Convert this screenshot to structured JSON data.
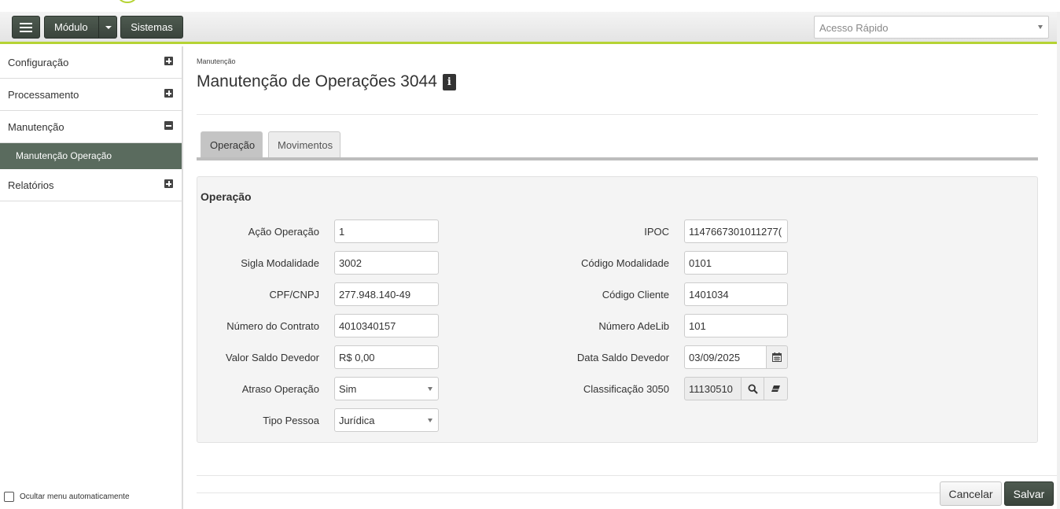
{
  "toolbar": {
    "module_label": "Módulo",
    "systems_label": "Sistemas",
    "quick_access_placeholder": "Acesso Rápido"
  },
  "sidebar": {
    "items": [
      {
        "label": "Configuração",
        "state": "collapsed"
      },
      {
        "label": "Processamento",
        "state": "collapsed"
      },
      {
        "label": "Manutenção",
        "state": "expanded"
      },
      {
        "label": "Relatórios",
        "state": "collapsed"
      }
    ],
    "sub_item": "Manutenção Operação",
    "hide_menu_label": "Ocultar menu automaticamente"
  },
  "page": {
    "breadcrumb": "Manutenção",
    "title": "Manutenção de Operações 3044"
  },
  "tabs": [
    {
      "label": "Operação",
      "active": true
    },
    {
      "label": "Movimentos",
      "active": false
    }
  ],
  "form": {
    "section_title": "Operação",
    "left": [
      {
        "label": "Ação Operação",
        "value": "1",
        "type": "text"
      },
      {
        "label": "Sigla Modalidade",
        "value": "3002",
        "type": "text"
      },
      {
        "label": "CPF/CNPJ",
        "value": "277.948.140-49",
        "type": "text"
      },
      {
        "label": "Número do Contrato",
        "value": "4010340157",
        "type": "text"
      },
      {
        "label": "Valor Saldo Devedor",
        "value": "R$ 0,00",
        "type": "text"
      },
      {
        "label": "Atraso Operação",
        "value": "Sim",
        "type": "select"
      },
      {
        "label": "Tipo Pessoa",
        "value": "Jurídica",
        "type": "select"
      }
    ],
    "right": [
      {
        "label": "IPOC",
        "value": "1147667301011277(",
        "type": "text"
      },
      {
        "label": "Código Modalidade",
        "value": "0101",
        "type": "text"
      },
      {
        "label": "Código Cliente",
        "value": "1401034",
        "type": "text"
      },
      {
        "label": "Número AdeLib",
        "value": "101",
        "type": "text"
      },
      {
        "label": "Data Saldo Devedor",
        "value": "03/09/2025",
        "type": "date"
      },
      {
        "label": "Classificação 3050",
        "value": "11130510",
        "type": "lookup"
      }
    ]
  },
  "actions": {
    "cancel_label": "Cancelar",
    "save_label": "Salvar"
  },
  "colors": {
    "accent": "#b5d334",
    "dark_button": "#3f4a41",
    "sidebar_active": "#5a6b5e"
  }
}
